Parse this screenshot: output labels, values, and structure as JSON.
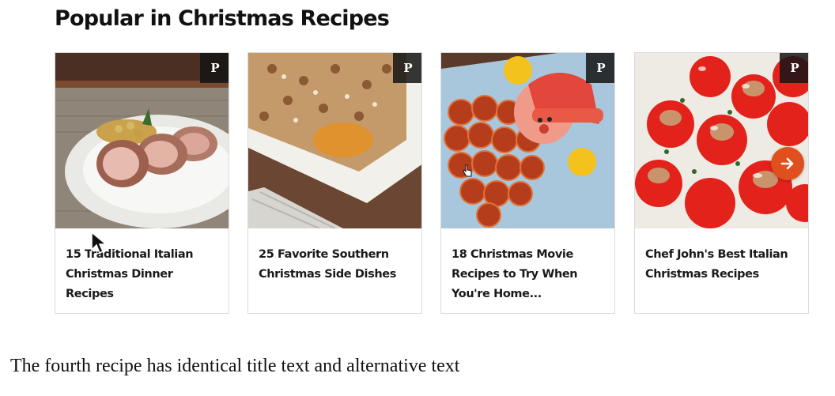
{
  "section": {
    "title": "Popular in Christmas Recipes"
  },
  "cards": [
    {
      "title": "15 Traditional Italian Christmas Dinner Recipes"
    },
    {
      "title": "25 Favorite Southern Christmas Side Dishes"
    },
    {
      "title": "18 Christmas Movie Recipes to Try When You're Home..."
    },
    {
      "title": "Chef John's Best Italian Christmas Recipes"
    }
  ],
  "carousel": {
    "next_icon": "arrow-right-icon",
    "accent": "#e0501e"
  },
  "pin_icon": "pinterest-icon",
  "note": "The fourth recipe has identical title text and alternative text"
}
